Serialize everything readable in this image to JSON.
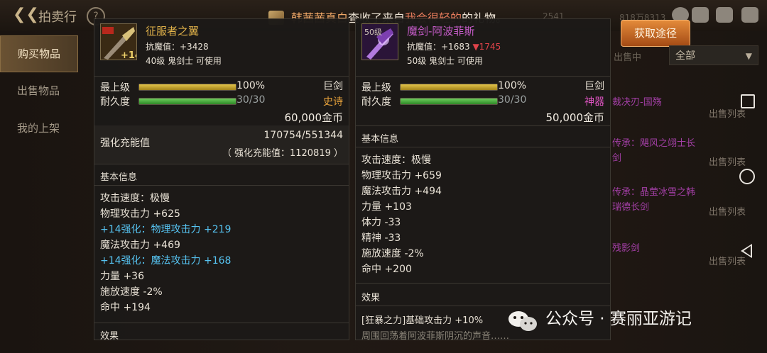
{
  "top": {
    "title": "拍卖行",
    "help": "?",
    "notice": {
      "sender": "韩茜茜真白",
      "mid": "查收了来自",
      "from": "我会很轻的",
      "tail": "的礼物。"
    },
    "faded1": "2541",
    "faded2": "818万8313",
    "colors": {
      "bar": "#241c15"
    }
  },
  "nav": [
    {
      "label": "购买物品",
      "active": true
    },
    {
      "label": "出售物品",
      "active": false
    },
    {
      "label": "我的上架",
      "active": false
    }
  ],
  "right": {
    "acquire_button": "获取途径",
    "filter_label": "出售中",
    "filter_value": "全部",
    "items": [
      {
        "name": "裁决刃-国殇"
      },
      {
        "name": "传承：飓风之翊士长剑"
      },
      {
        "name": "传承：晶莹冰雪之韩瑞德长剑"
      },
      {
        "name": "残影剑"
      }
    ],
    "sale_list_label": "出售列表"
  },
  "left_panel": {
    "name": "征服者之翼",
    "anti_magic": "抗魔值：+3428",
    "requirement": "40级 鬼剑士 可使用",
    "enhance_badge": "+14",
    "top_level_label": "最上级",
    "top_level_value": "100%",
    "top_level_percent": 100,
    "weapon_type": "巨剑",
    "durability_label": "耐久度",
    "durability_value": "30/30",
    "durability_percent": 100,
    "rarity": "史诗",
    "price": "60,000金币",
    "charge_label": "强化充能值",
    "charge_value": "170754/551344",
    "charge_sub": "（ 强化充能值：1120819 ）",
    "basic_title": "基本信息",
    "stats": [
      {
        "text": "攻击速度：极慢",
        "color": "white"
      },
      {
        "text": "物理攻击力 +625",
        "color": "white"
      },
      {
        "text": "+14强化：物理攻击力 +219",
        "color": "cyan"
      },
      {
        "text": "魔法攻击力 +469",
        "color": "white"
      },
      {
        "text": "+14强化：魔法攻击力 +168",
        "color": "cyan"
      },
      {
        "text": "力量 +36",
        "color": "white"
      },
      {
        "text": "施放速度 -2%",
        "color": "white"
      },
      {
        "text": "命中 +194",
        "color": "white"
      }
    ],
    "next_section": "效果"
  },
  "right_panel": {
    "name": "魔剑-阿波菲斯",
    "level_badge": "50级",
    "anti_magic": "抗魔值：+1683",
    "anti_magic_diff": "▼1745",
    "requirement": "50级 鬼剑士 可使用",
    "top_level_label": "最上级",
    "top_level_value": "100%",
    "top_level_percent": 100,
    "weapon_type": "巨剑",
    "durability_label": "耐久度",
    "durability_value": "30/30",
    "durability_percent": 100,
    "rarity": "神器",
    "price": "50,000金币",
    "basic_title": "基本信息",
    "stats": [
      {
        "text": "攻击速度：极慢"
      },
      {
        "text": "物理攻击力 +659"
      },
      {
        "text": "魔法攻击力 +494"
      },
      {
        "text": "力量 +103"
      },
      {
        "text": "体力 -33"
      },
      {
        "text": "精神 -33"
      },
      {
        "text": "施放速度 -2%"
      },
      {
        "text": "命中 +200"
      }
    ],
    "effect_title": "效果",
    "effect_line1": "[狂暴之力]基础攻击力 +10%",
    "effect_line2": "周围回荡着阿波菲斯阴沉的声音……"
  },
  "watermark": {
    "text": "公众号 · 赛丽亚游记"
  }
}
